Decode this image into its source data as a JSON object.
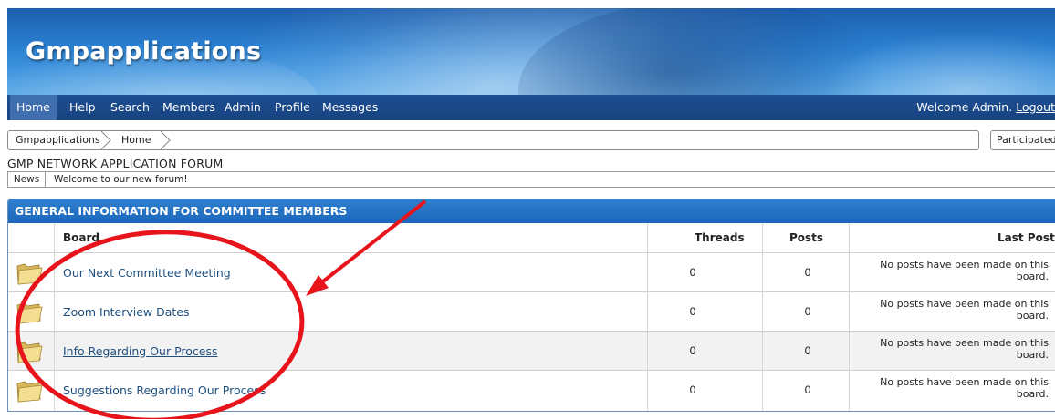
{
  "header": {
    "site_title": "Gmpapplications"
  },
  "nav": {
    "items": [
      "Home",
      "Help",
      "Search",
      "Members",
      "Admin",
      "Profile",
      "Messages"
    ],
    "active": "Home",
    "welcome_text": "Welcome Admin.",
    "logout_label": "Logout"
  },
  "breadcrumb": {
    "items": [
      "Gmpapplications",
      "Home"
    ],
    "participated_label": "Participated"
  },
  "forum": {
    "title": "GMP NETWORK APPLICATION FORUM"
  },
  "news": {
    "label": "News",
    "text": "Welcome to our new forum!"
  },
  "category": {
    "title": "GENERAL INFORMATION FOR COMMITTEE MEMBERS",
    "columns": {
      "board": "Board",
      "threads": "Threads",
      "posts": "Posts",
      "last_post": "Last Post"
    },
    "boards": [
      {
        "name": "Our Next Committee Meeting",
        "threads": "0",
        "posts": "0",
        "last_post": "No posts have been made on this board."
      },
      {
        "name": "Zoom Interview Dates",
        "threads": "0",
        "posts": "0",
        "last_post": "No posts have been made on this board."
      },
      {
        "name": "Info Regarding Our Process",
        "threads": "0",
        "posts": "0",
        "last_post": "No posts have been made on this board."
      },
      {
        "name": "Suggestions Regarding Our Process",
        "threads": "0",
        "posts": "0",
        "last_post": "No posts have been made on this board."
      }
    ]
  },
  "annotation": {
    "color": "#e8141b"
  },
  "icons": {
    "board": "folder-icon",
    "breadcrumb_separator": "chevron-right-icon"
  }
}
